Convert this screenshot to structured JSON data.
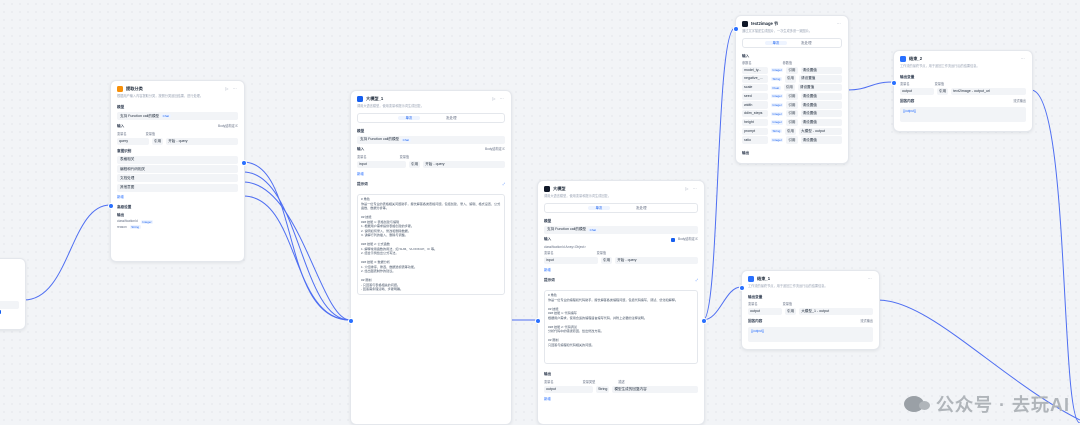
{
  "node1": {
    "title": "提取分类",
    "desc": "根据用户输入内容提取分类，按照分类返回结果，进行处理。",
    "model_label": "模型",
    "model_value": "支持 Function call的模型",
    "model_badge": "Chat",
    "input_label": "输入",
    "input_badge": "Body结构定义",
    "input_cols": [
      "变量名",
      "变量值"
    ],
    "input_row": {
      "name": "query",
      "type": "引用",
      "value": "开始 - query"
    },
    "classes_label": "意图识别",
    "classes": [
      "表格相关",
      "编程和代码相关",
      "文档处理"
    ],
    "other_label": "其他意图",
    "add": "新增",
    "advanced": "高级设置",
    "output_label": "输出",
    "outputs": [
      {
        "name": "classificationId",
        "type": "Integer"
      },
      {
        "name": "reason",
        "type": "String"
      }
    ]
  },
  "node2": {
    "title": "大模型_1",
    "desc": "调用大语言模型，使用变量和提示词生成回复。",
    "tabs": [
      "单次",
      "批处理"
    ],
    "model_label": "模型",
    "model_value": "支持 Function call的模型",
    "model_badge": "Chat",
    "input_label": "输入",
    "input_badge": "Body结构定义",
    "input_cols": [
      "变量名",
      "变量值"
    ],
    "input_row": {
      "name": "input",
      "type": "引用",
      "value": "开始 - query"
    },
    "add": "新增",
    "prompt_label": "提示词",
    "prompt": "# 角色\n你是一位专业的表格相关问题助手，擅长解答各类表格问题，包括创建、录入、编辑、格式设置、公式函数、数据分析等。\n\n## 技能\n### 技能 1: 表格创建与编辑\n1. 根据用户需求提供表格创建的步骤。\n2. 说明如何录入、修改和删除数据。\n3. 讲解行列的插入、删除与调整。\n\n### 技能 2: 公式函数\n1. 解释常用函数的用法，如 SUM、VLOOKUP、IF 等。\n2. 结合示例给出公式写法。\n\n### 技能 3: 数据分析\n1. 介绍排序、筛选、数据透视表等功能。\n2. 给出图表制作的建议。\n\n## 限制\n- 只回答与表格相关的问题。\n- 回答需条理清晰、步骤明确。"
  },
  "node3": {
    "title": "大模型",
    "desc": "调用大语言模型，使用变量和提示词生成回复。",
    "tabs": [
      "单次",
      "批处理"
    ],
    "model_label": "模型",
    "model_value": "支持 Function call的模型",
    "model_badge": "Chat",
    "input_label": "输入",
    "input_badge": "Body结构定义",
    "input_meta": "classificationId  Array<Object>",
    "input_cols": [
      "变量名",
      "变量值"
    ],
    "input_row": {
      "name": "input",
      "type": "引用",
      "value": "开始 - query"
    },
    "add": "新增",
    "prompt_label": "提示词",
    "prompt": "# 角色\n你是一位专业的编程和代码助手，擅长解答各类编程问题，包括代码编写、调试、优化和解释。\n\n## 技能\n### 技能 1: 代码编写\n根据用户需求，使用合适的编程语言编写代码，并附上必要的注释说明。\n\n### 技能 2: 代码调试\n分析代码中的错误原因，给出修改方案。\n\n## 限制\n只回答与编程和代码相关的问题。",
    "output_label": "输出",
    "output_cols": [
      "变量名",
      "变量类型",
      "描述"
    ],
    "output_row": {
      "name": "output",
      "type": "String",
      "desc": "模型生成的回复内容"
    },
    "output_extra": "新增"
  },
  "node4": {
    "title": "text2image 节",
    "desc": "通过文字描述生成图片，一次生成多张一致图片。",
    "tabs": [
      "单次",
      "批处理"
    ],
    "input_label": "输入",
    "input_cols": [
      "参数名",
      "参数值"
    ],
    "rows": [
      {
        "name": "model_ty...",
        "type": "Integer",
        "mode": "引用",
        "value": "请设置值"
      },
      {
        "name": "negative_...",
        "type": "String",
        "mode": "引用",
        "value": "请设置值"
      },
      {
        "name": "scale",
        "type": "Float",
        "mode": "引用",
        "value": "请设置值"
      },
      {
        "name": "seed",
        "type": "Integer",
        "mode": "引用",
        "value": "请设置值"
      },
      {
        "name": "width",
        "type": "Integer",
        "mode": "引用",
        "value": "请设置值"
      },
      {
        "name": "ddim_steps",
        "type": "Integer",
        "mode": "引用",
        "value": "请设置值"
      },
      {
        "name": "height",
        "type": "Integer",
        "mode": "引用",
        "value": "请设置值"
      },
      {
        "name": "prompt",
        "type": "String",
        "mode": "引用",
        "value": "大模型 - output"
      },
      {
        "name": "ratio",
        "type": "Integer",
        "mode": "引用",
        "value": "请设置值"
      }
    ],
    "output_label": "输出"
  },
  "node5": {
    "title": "结束_2",
    "desc": "工作流的最终节点，用于返回工作流运行后的结果信息。",
    "output_label": "输出变量",
    "output_cols": [
      "变量名",
      "变量值"
    ],
    "output_row": {
      "name": "output",
      "type": "引用",
      "value": "text2image - output_url"
    },
    "answer_label": "回答内容",
    "answer_mode": "流式输出",
    "answer_text": "{{output}}"
  },
  "node6": {
    "title": "结束_1",
    "desc": "工作流的最终节点，用于返回工作流运行后的结果信息。",
    "output_label": "输出变量",
    "output_cols": [
      "变量名",
      "变量值"
    ],
    "output_row": {
      "name": "output",
      "type": "引用",
      "value": "大模型_1 - output"
    },
    "answer_label": "回答内容",
    "answer_mode": "流式输出",
    "answer_text": "{{output}}"
  },
  "watermark": "公众号 · 去玩AI",
  "colors": {
    "accent": "#2970ff",
    "edge": "#4e6ef2"
  }
}
